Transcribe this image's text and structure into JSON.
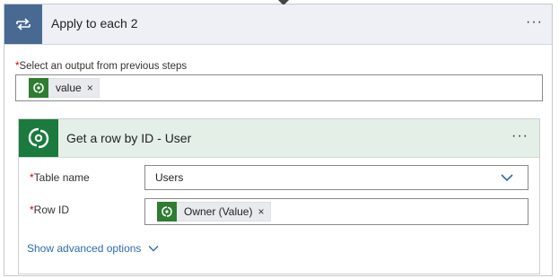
{
  "loop": {
    "title": "Apply to each 2",
    "more": "···",
    "output_label": "Select an output from previous steps",
    "required_mark": "*",
    "token": {
      "label": "value",
      "close": "×"
    }
  },
  "action": {
    "title": "Get a row by ID - User",
    "more": "···",
    "table_name": {
      "label": "Table name",
      "required_mark": "*",
      "value": "Users"
    },
    "row_id": {
      "label": "Row ID",
      "required_mark": "*",
      "token_label": "Owner (Value)",
      "close": "×"
    },
    "advanced_label": "Show advanced options"
  },
  "colors": {
    "loop_header": "#486991",
    "dataverse_green": "#1b7a3d",
    "link_blue": "#2b6cb0"
  },
  "icons": {
    "loop": "loop-icon",
    "connector": "dataverse-icon",
    "dropdown": "chevron-down-icon"
  }
}
